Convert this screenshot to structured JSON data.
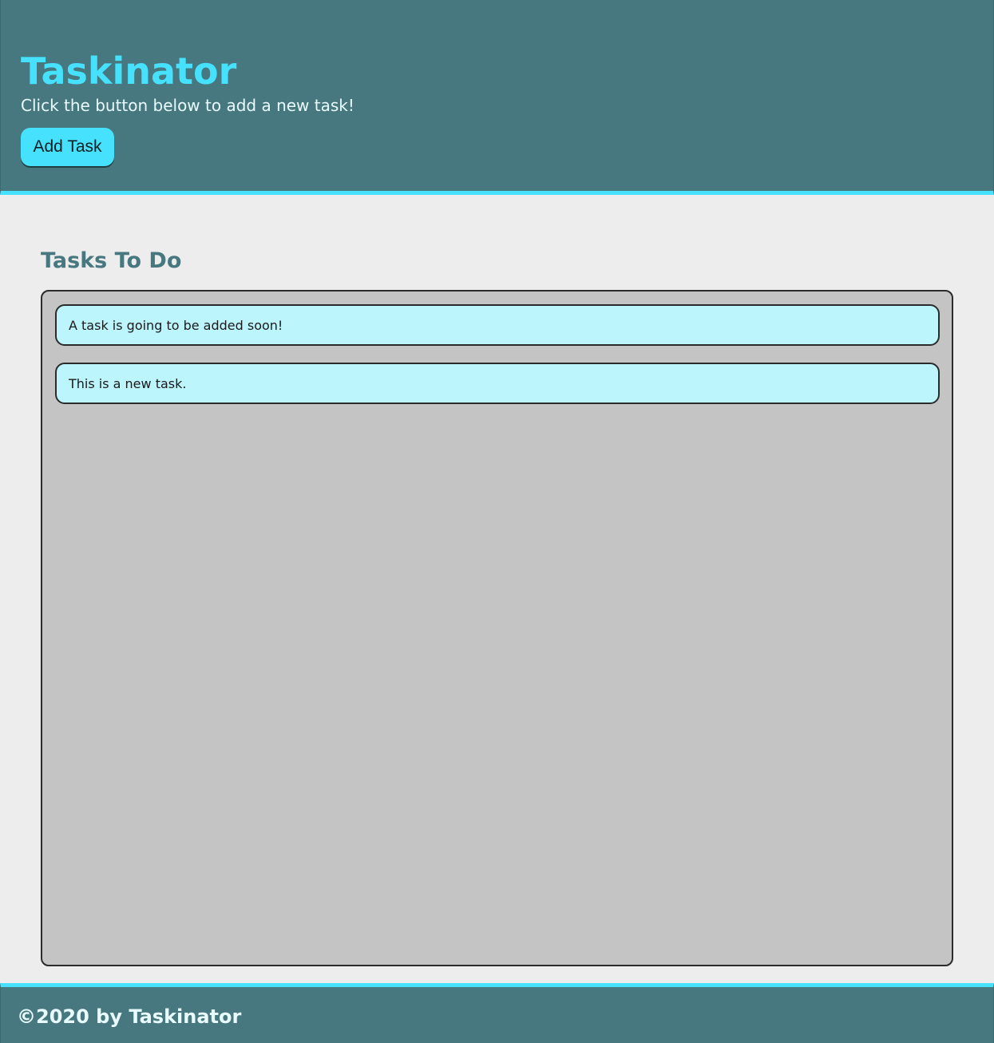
{
  "header": {
    "title": "Taskinator",
    "subtitle": "Click the button below to add a new task!",
    "add_button_label": "Add Task"
  },
  "main": {
    "list_title": "Tasks To Do",
    "tasks": [
      {
        "label": "A task is going to be added soon!"
      },
      {
        "label": "This is a new task."
      }
    ]
  },
  "footer": {
    "text": "©2020 by Taskinator"
  },
  "colors": {
    "header_bg": "#48787f",
    "accent": "#46e1fc",
    "page_bg": "#ededed",
    "list_bg": "#c4c4c4",
    "task_bg": "#bdf5fd",
    "list_title": "#48787f"
  }
}
